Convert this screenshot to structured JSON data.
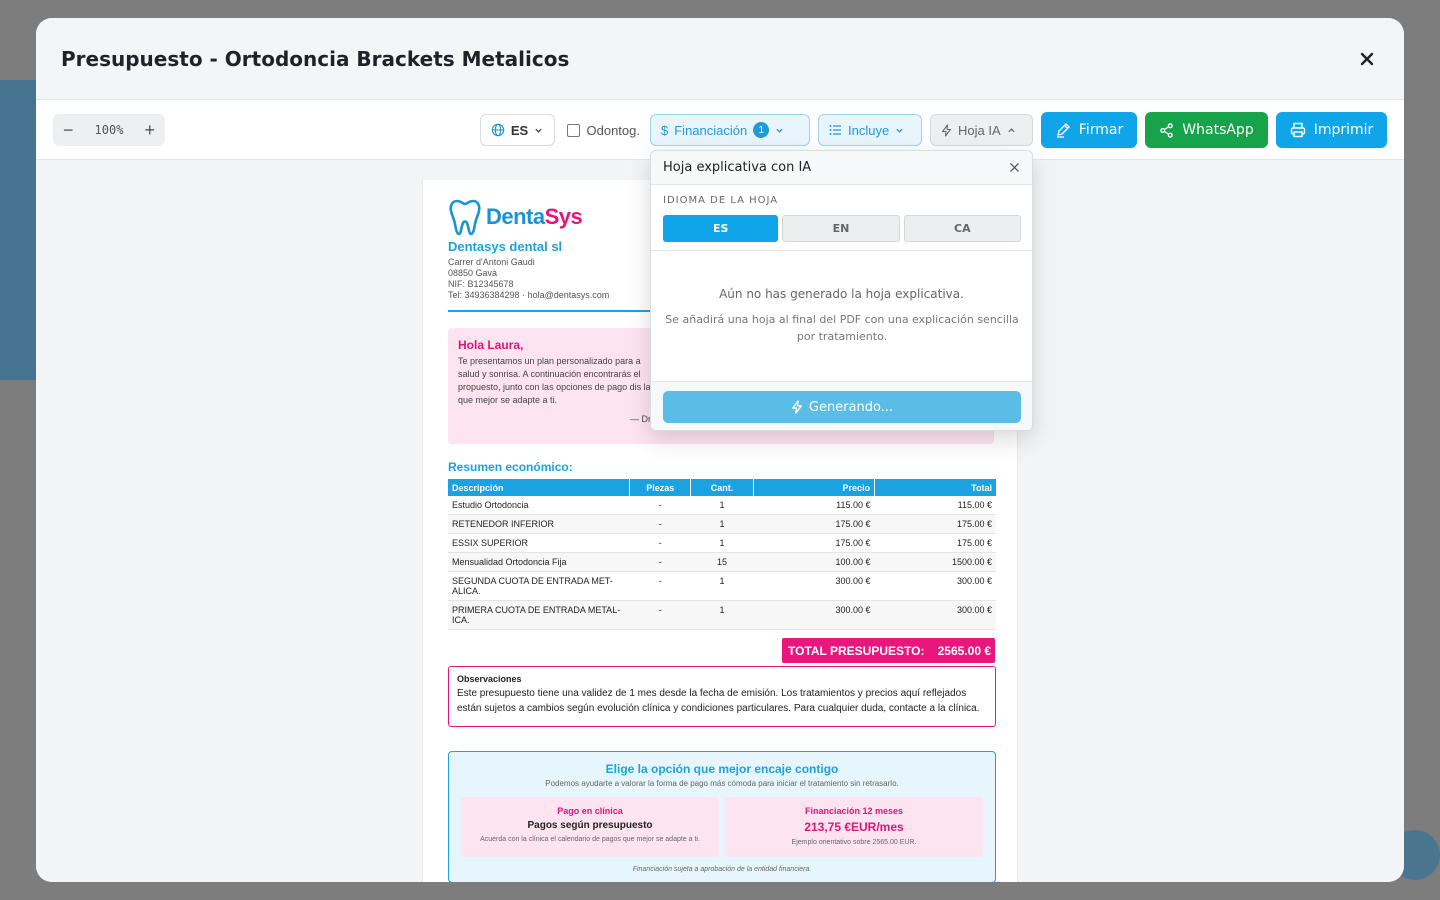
{
  "modal": {
    "title": "Presupuesto - Ortodoncia Brackets Metalicos"
  },
  "toolbar": {
    "zoom": "100%",
    "language": "ES",
    "odontogram_label": "Odontog.",
    "financing_label": "Financiación",
    "financing_count": "1",
    "includes_label": "Incluye",
    "ai_sheet_label": "Hoja IA",
    "sign_label": "Firmar",
    "whatsapp_label": "WhatsApp",
    "print_label": "Imprimir"
  },
  "document": {
    "logo_part1": "Denta",
    "logo_part2": "Sys",
    "clinic_name": "Dentasys dental sl",
    "address_line1": "Carrer d'Antoni Gaudi",
    "address_line2": "08850 Gavà",
    "nif": "NIF: B12345678",
    "contact": "Tel: 34936384298 · hola@dentasys.com",
    "greeting": "Hola Laura,",
    "intro": "Te presentamos un plan personalizado para a salud y sonrisa. A continuación encontrarás el propuesto, junto con las opciones de pago dis la que mejor se adapte a ti.",
    "signature": "— Dr",
    "summary_title": "Resumen económico:",
    "columns": [
      "Descripción",
      "Piezas",
      "Cant.",
      "Precio",
      "Total"
    ],
    "rows": [
      {
        "desc": "Estudio Ortodoncia",
        "pieces": "-",
        "qty": "1",
        "price": "115.00 €",
        "total": "115.00 €"
      },
      {
        "desc": "RETENEDOR INFERIOR",
        "pieces": "-",
        "qty": "1",
        "price": "175.00 €",
        "total": "175.00 €"
      },
      {
        "desc": "ESSIX SUPERIOR",
        "pieces": "-",
        "qty": "1",
        "price": "175.00 €",
        "total": "175.00 €"
      },
      {
        "desc": "Mensualidad Ortodoncia Fija",
        "pieces": "-",
        "qty": "15",
        "price": "100.00 €",
        "total": "1500.00 €"
      },
      {
        "desc": "SEGUNDA CUOTA DE ENTRADA MET-ALICA.",
        "pieces": "-",
        "qty": "1",
        "price": "300.00 €",
        "total": "300.00 €"
      },
      {
        "desc": "PRIMERA CUOTA DE ENTRADA METAL-ICA.",
        "pieces": "-",
        "qty": "1",
        "price": "300.00 €",
        "total": "300.00 €"
      }
    ],
    "total_label": "TOTAL PRESUPUESTO:",
    "total_value": "2565.00 €",
    "observations_title": "Observaciones",
    "observations_text": "Este presupuesto tiene una validez de 1 mes desde la fecha de emisión. Los tratamientos y precios aquí reflejados están sujetos a cambios según evolución clínica y condiciones particulares. Para cualquier duda, contacte a la clínica.",
    "options_title": "Elige la opción que mejor encaje contigo",
    "options_subtitle": "Podemos ayudarte a valorar la forma de pago más cómoda para iniciar el tratamiento sin retrasarlo.",
    "option1_title": "Pago en clínica",
    "option1_value": "Pagos según presupuesto",
    "option1_note": "Acuerda con la clínica el calendario de pagos que mejor se adapte a ti.",
    "option2_title": "Financiación 12 meses",
    "option2_value": "213,75 €EUR/mes",
    "option2_note": "Ejemplo orientativo sobre 2565.00 EUR.",
    "options_footer": "Financiación sujeta a aprobación de la entidad financiera."
  },
  "popover": {
    "title": "Hoja explicativa con IA",
    "language_label": "IDIOMA DE LA HOJA",
    "languages": [
      "ES",
      "EN",
      "CA"
    ],
    "selected_language": "ES",
    "empty_title": "Aún no has generado la hoja explicativa.",
    "empty_desc": "Se añadirá una hoja al final del PDF con una explicación sencilla por tratamiento.",
    "generate_label": "Generando..."
  },
  "colors": {
    "primary": "#10a5e8",
    "whatsapp": "#16a34a",
    "accent_pink": "#e8177e"
  }
}
